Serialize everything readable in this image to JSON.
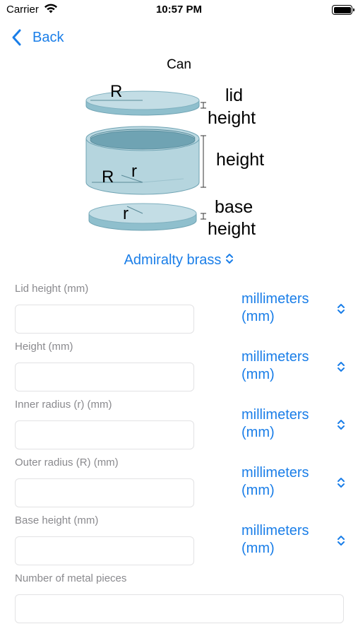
{
  "status_bar": {
    "carrier": "Carrier",
    "time": "10:57 PM"
  },
  "nav": {
    "back_label": "Back"
  },
  "diagram": {
    "title": "Can",
    "labels": {
      "lid_radius": "R",
      "body_outer_radius": "R",
      "body_inner_radius": "r",
      "base_radius": "r",
      "lid_height_line1": "lid",
      "lid_height_line2": "height",
      "height": "height",
      "base_height_line1": "base",
      "base_height_line2": "height"
    }
  },
  "material": {
    "selected": "Admiralty brass"
  },
  "fields": [
    {
      "label": "Lid height (mm)",
      "value": "",
      "unit_line1": "millimeters",
      "unit_line2": "(mm)"
    },
    {
      "label": "Height (mm)",
      "value": "",
      "unit_line1": "millimeters",
      "unit_line2": "(mm)"
    },
    {
      "label": "Inner radius (r) (mm)",
      "value": "",
      "unit_line1": "millimeters",
      "unit_line2": "(mm)"
    },
    {
      "label": "Outer radius (R) (mm)",
      "value": "",
      "unit_line1": "millimeters",
      "unit_line2": "(mm)"
    },
    {
      "label": "Base height (mm)",
      "value": "",
      "unit_line1": "millimeters",
      "unit_line2": "(mm)"
    }
  ],
  "pieces": {
    "label": "Number of metal pieces",
    "value": ""
  },
  "colors": {
    "accent": "#1a7ee8",
    "can_fill": "#b9d7e0",
    "can_dark": "#6fa3b3",
    "label_gray": "#8a8a8e"
  }
}
